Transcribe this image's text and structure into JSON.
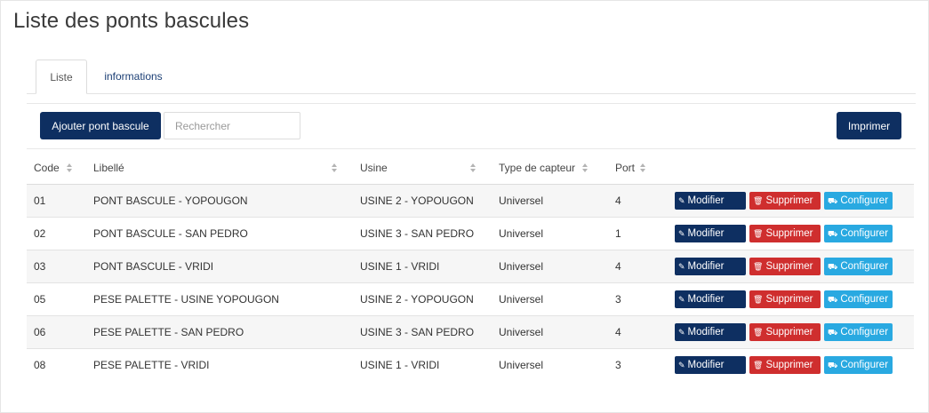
{
  "page": {
    "title": "Liste des ponts bascules"
  },
  "tabs": [
    {
      "label": "Liste",
      "active": true
    },
    {
      "label": "informations",
      "active": false
    }
  ],
  "toolbar": {
    "add_label": "Ajouter pont bascule",
    "search_placeholder": "Rechercher",
    "search_value": "",
    "print_label": "Imprimer"
  },
  "table": {
    "columns": [
      "Code",
      "Libellé",
      "Usine",
      "Type de capteur",
      "Port"
    ],
    "action_labels": {
      "edit": "Modifier",
      "delete": "Supprimer",
      "configure": "Configurer"
    },
    "rows": [
      {
        "code": "01",
        "libelle": "PONT BASCULE - YOPOUGON",
        "usine": "USINE 2 - YOPOUGON",
        "type": "Universel",
        "port": "4"
      },
      {
        "code": "02",
        "libelle": "PONT BASCULE - SAN PEDRO",
        "usine": "USINE 3 - SAN PEDRO",
        "type": "Universel",
        "port": "1"
      },
      {
        "code": "03",
        "libelle": "PONT BASCULE - VRIDI",
        "usine": "USINE 1 - VRIDI",
        "type": "Universel",
        "port": "4"
      },
      {
        "code": "05",
        "libelle": "PESE PALETTE - USINE YOPOUGON",
        "usine": "USINE 2 - YOPOUGON",
        "type": "Universel",
        "port": "3"
      },
      {
        "code": "06",
        "libelle": "PESE PALETTE - SAN PEDRO",
        "usine": "USINE 3 - SAN PEDRO",
        "type": "Universel",
        "port": "4"
      },
      {
        "code": "08",
        "libelle": "PESE PALETTE - VRIDI",
        "usine": "USINE 1 - VRIDI",
        "type": "Universel",
        "port": "3"
      }
    ]
  },
  "colors": {
    "primary": "#0e2f61",
    "danger": "#cf2e2e",
    "info": "#29a9e1"
  },
  "icons": {
    "edit": "edit-icon",
    "delete": "trash-icon",
    "configure": "truck-icon",
    "sort": "sort-icon"
  }
}
